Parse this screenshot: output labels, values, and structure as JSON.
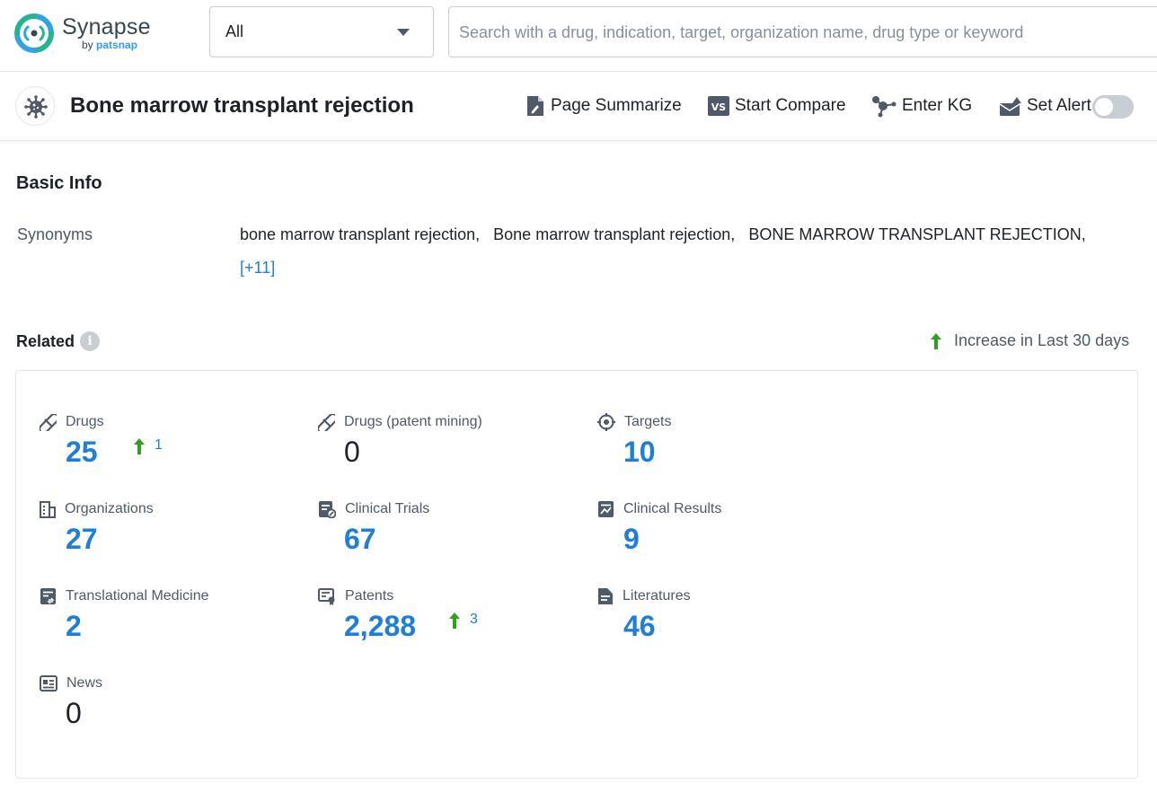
{
  "brand": {
    "name": "Synapse",
    "by": "by",
    "by_brand": "patsnap"
  },
  "search": {
    "scope_value": "All",
    "placeholder": "Search with a drug, indication, target, organization name, drug type or keyword"
  },
  "header": {
    "title": "Bone marrow transplant rejection",
    "actions": {
      "summarize": "Page Summarize",
      "compare": "Start Compare",
      "kg": "Enter KG",
      "alert": "Set Alert"
    },
    "alert_enabled": false
  },
  "basic_info": {
    "title": "Basic Info",
    "synonyms_label": "Synonyms",
    "synonyms": [
      "bone marrow transplant rejection,",
      "Bone marrow transplant rejection,",
      "BONE MARROW TRANSPLANT REJECTION,"
    ],
    "more": "[+11]"
  },
  "related": {
    "title": "Related",
    "info_icon": "i",
    "legend": "Increase in Last 30 days",
    "stats": [
      {
        "label": "Drugs",
        "value": "25",
        "increase": "1",
        "icon": "pill-icon"
      },
      {
        "label": "Drugs (patent mining)",
        "value": "0",
        "icon": "pill-icon"
      },
      {
        "label": "Targets",
        "value": "10",
        "icon": "target-icon"
      },
      {
        "label": "Organizations",
        "value": "27",
        "icon": "building-icon"
      },
      {
        "label": "Clinical Trials",
        "value": "67",
        "icon": "clinical-trial-icon"
      },
      {
        "label": "Clinical Results",
        "value": "9",
        "icon": "clinical-result-icon"
      },
      {
        "label": "Translational Medicine",
        "value": "2",
        "icon": "translational-icon"
      },
      {
        "label": "Patents",
        "value": "2,288",
        "increase": "3",
        "icon": "patent-icon"
      },
      {
        "label": "Literatures",
        "value": "46",
        "icon": "document-icon"
      },
      {
        "label": "News",
        "value": "0",
        "icon": "news-icon"
      }
    ]
  },
  "colors": {
    "accent": "#1f7ed8",
    "increase": "#2ea121",
    "text": "#1d2129",
    "muted": "#4e5969"
  }
}
